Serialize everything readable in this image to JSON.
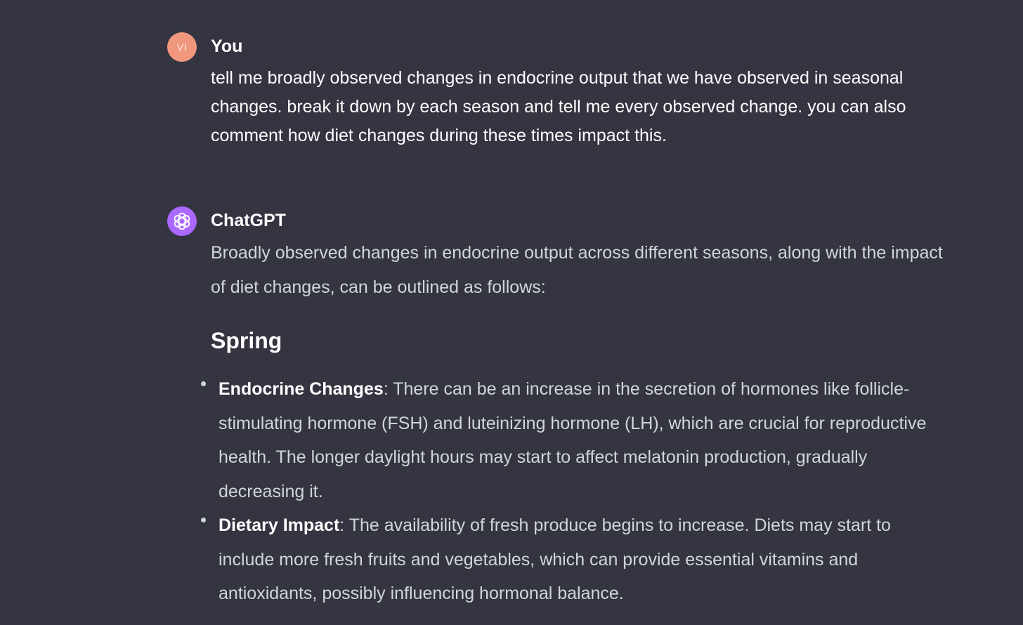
{
  "user_message": {
    "avatar_initials": "VI",
    "avatar_color": "#f1977e",
    "author": "You",
    "text": "tell me broadly observed changes in endocrine output that we have observed in seasonal changes. break it down by each season and tell me every observed change. you can also comment how diet changes during these times impact this."
  },
  "assistant_message": {
    "avatar_icon": "openai-logo-icon",
    "avatar_color": "#ab68ff",
    "author": "ChatGPT",
    "intro": "Broadly observed changes in endocrine output across different seasons, along with the impact of diet changes, can be outlined as follows:",
    "sections": [
      {
        "heading": "Spring",
        "bullets": [
          {
            "label": "Endocrine Changes",
            "text": ": There can be an increase in the secretion of hormones like follicle-stimulating hormone (FSH) and luteinizing hormone (LH), which are crucial for reproductive health. The longer daylight hours may start to affect melatonin production, gradually decreasing it."
          },
          {
            "label": "Dietary Impact",
            "text": ": The availability of fresh produce begins to increase. Diets may start to include more fresh fruits and vegetables, which can provide essential vitamins and antioxidants, possibly influencing hormonal balance."
          }
        ]
      }
    ]
  }
}
